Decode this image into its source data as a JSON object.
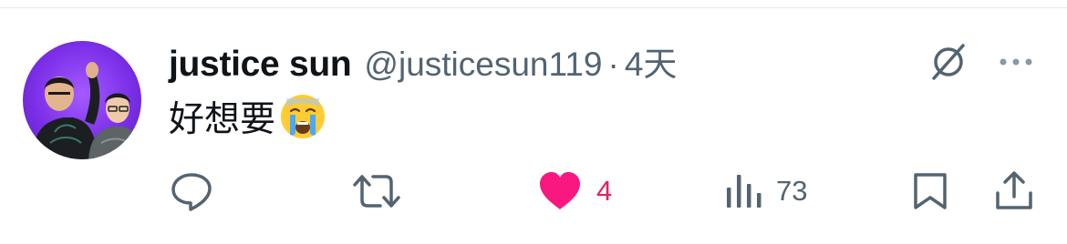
{
  "tweet": {
    "author_name": "justice sun",
    "author_handle": "@justicesun119",
    "separator": "·",
    "time_ago": "4天",
    "text": "好想要"
  },
  "emoji": "crying-face",
  "stats": {
    "likes": "4",
    "views": "73"
  },
  "colors": {
    "like_active": "#f91880",
    "secondary_text": "#536471",
    "avatar_bg": "#7b2fe8"
  },
  "icons": {
    "reply": "reply-bubble-icon",
    "retweet": "retweet-icon",
    "like": "heart-filled-icon",
    "views": "views-bar-chart-icon",
    "bookmark": "bookmark-icon",
    "share": "share-upload-icon",
    "grok": "grok-icon",
    "more": "more-horizontal-icon"
  }
}
